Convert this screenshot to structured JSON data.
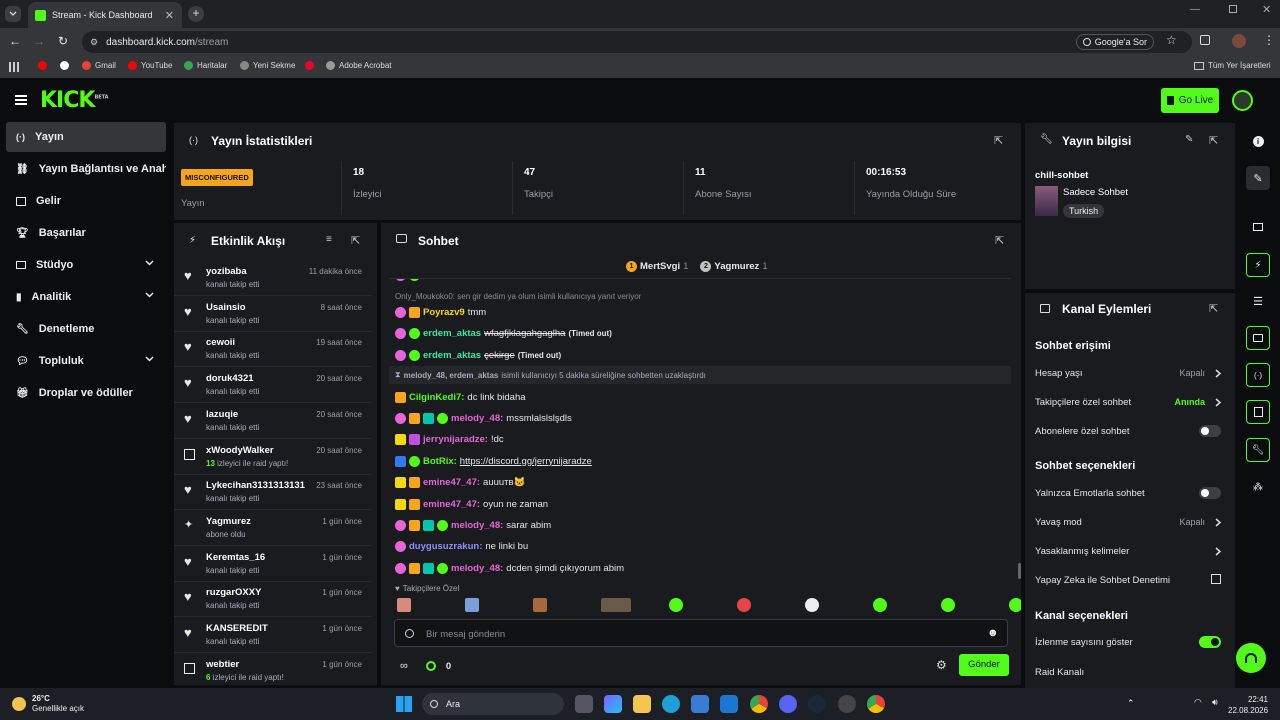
{
  "browser": {
    "tab_title": "Stream - Kick Dashboard",
    "url_host": "dashboard.kick.com",
    "url_path": "/stream",
    "google_btn": "Google'a Sor",
    "bookmarks": [
      "Gmail",
      "YouTube",
      "Haritalar",
      "Yeni Sekme",
      "Adobe Acrobat"
    ],
    "all_bookmarks": "Tüm Yer İşaretleri"
  },
  "topnav": {
    "logo": "KICK",
    "logo_badge": "BETA",
    "go_live": "Go Live"
  },
  "sidebar": {
    "items": [
      {
        "label": "Yayın"
      },
      {
        "label": "Yayın Bağlantısı ve Anahtarı"
      },
      {
        "label": "Gelir"
      },
      {
        "label": "Başarılar"
      },
      {
        "label": "Stüdyo"
      },
      {
        "label": "Analitik"
      },
      {
        "label": "Denetleme"
      },
      {
        "label": "Topluluk"
      },
      {
        "label": "Droplar ve ödüller"
      }
    ]
  },
  "stats": {
    "title": "Yayın İstatistikleri",
    "status_badge": "MISCONFIGURED",
    "status_label": "Yayın",
    "items": [
      {
        "value": "18",
        "label": "İzleyici"
      },
      {
        "value": "47",
        "label": "Takipçi"
      },
      {
        "value": "11",
        "label": "Abone Sayısı"
      },
      {
        "value": "00:16:53",
        "label": "Yayında Olduğu Süre"
      }
    ]
  },
  "events": {
    "title": "Etkinlik Akışı",
    "rows": [
      {
        "name": "yozibaba",
        "sub": "kanalı takip etti",
        "time": "11 dakika önce",
        "icon": "heart-icon"
      },
      {
        "name": "Usainsio",
        "sub": "kanalı takip etti",
        "time": "8 saat önce",
        "icon": "heart-icon"
      },
      {
        "name": "cewoii",
        "sub": "kanalı takip etti",
        "time": "19 saat önce",
        "icon": "heart-icon"
      },
      {
        "name": "doruk4321",
        "sub": "kanalı takip etti",
        "time": "20 saat önce",
        "icon": "heart-icon"
      },
      {
        "name": "lazuqie",
        "sub": "kanalı takip etti",
        "time": "20 saat önce",
        "icon": "heart-icon"
      },
      {
        "name": "xWoodyWalker",
        "sub_count": "13",
        "sub": "izleyici ile raid yaptı!",
        "time": "20 saat önce",
        "icon": "raid-icon"
      },
      {
        "name": "Lykecihan3131313131",
        "sub": "kanalı takip etti",
        "time": "23 saat önce",
        "icon": "heart-icon"
      },
      {
        "name": "Yagmurez",
        "sub": "abone oldu",
        "time": "1 gün önce",
        "icon": "sparkle-icon"
      },
      {
        "name": "Keremtas_16",
        "sub": "kanalı takip etti",
        "time": "1 gün önce",
        "icon": "heart-icon"
      },
      {
        "name": "ruzgarOXXY",
        "sub": "kanalı takip etti",
        "time": "1 gün önce",
        "icon": "heart-icon"
      },
      {
        "name": "KANSEREDIT",
        "sub": "kanalı takip etti",
        "time": "1 gün önce",
        "icon": "heart-icon"
      },
      {
        "name": "webtier",
        "sub_count": "6",
        "sub": "izleyici ile raid yaptı!",
        "time": "1 gün önce",
        "icon": "raid-icon"
      }
    ]
  },
  "chat": {
    "title": "Sohbet",
    "top_gifters": [
      {
        "rank": "1",
        "name": "MertSvgi",
        "count": "1"
      },
      {
        "rank": "2",
        "name": "Yagmurez",
        "count": "1"
      }
    ],
    "system1": "Only_Moukoko0: sen gir dedim ya olum isimli kullanıcıya yanıt veriyor",
    "messages": [
      {
        "user": "Poyrazv9",
        "color": "#f5d90a",
        "text": "tmm",
        "badges": [
          "sub",
          "crown"
        ]
      },
      {
        "user": "erdem_aktas",
        "color": "#3ee6a0",
        "text": "wfagfjklagahgaglha",
        "strike": true,
        "suffix": "(Timed out)",
        "badges": [
          "sub",
          "green"
        ]
      },
      {
        "user": "erdem_aktas",
        "color": "#3ee6a0",
        "text": "çekirge",
        "strike": true,
        "suffix": "(Timed out)",
        "badges": [
          "sub",
          "green"
        ]
      }
    ],
    "system2_users": "melody_48, erdem_aktas",
    "system2_text": "isimli kullanıcıyı 5 dakika süreliğine sohbetten uzaklaştırdı",
    "messages2": [
      {
        "user": "CilginKedi7:",
        "color": "#53fc18",
        "text": "dc link bidaha",
        "badges": [
          "crown"
        ]
      },
      {
        "user": "melody_48:",
        "color": "#e764d9",
        "text": "mssmlalslslşdls",
        "badges": [
          "sub",
          "crown",
          "mod",
          "green"
        ]
      },
      {
        "user": "jerrynijaradze:",
        "color": "#e764d9",
        "text": "!dc",
        "badges": [
          "kick",
          "mic"
        ]
      },
      {
        "user": "BotRix:",
        "color": "#53fc18",
        "text": "https://discord.gg/jerrynijaradze",
        "badges": [
          "bot",
          "verified"
        ]
      },
      {
        "user": "emine47_47:",
        "color": "#e764d9",
        "text": "auuuтв🐱",
        "badges": [
          "sub1",
          "crown"
        ]
      },
      {
        "user": "emine47_47:",
        "color": "#e764d9",
        "text": "oyun ne zaman",
        "badges": [
          "sub1",
          "crown"
        ]
      },
      {
        "user": "melody_48:",
        "color": "#e764d9",
        "text": "sarar abim",
        "badges": [
          "sub",
          "crown",
          "mod",
          "green"
        ]
      },
      {
        "user": "duygusuzrakun:",
        "color": "#8f8fff",
        "text": "ne linki bu",
        "badges": [
          "sub"
        ]
      },
      {
        "user": "melody_48:",
        "color": "#e764d9",
        "text": "dcden şimdi çıkıyorum abim",
        "badges": [
          "sub",
          "crown",
          "mod",
          "green"
        ]
      }
    ],
    "followers_only": "Takipçilere Özel",
    "input_placeholder": "Bir mesaj gönderin",
    "points": "0",
    "send": "Gönder"
  },
  "info": {
    "title": "Yayın bilgisi",
    "stream_title": "chill-sohbet",
    "category": "Sadece Sohbet",
    "tag": "Turkish"
  },
  "actions": {
    "title": "Kanal Eylemleri",
    "chat_access": "Sohbet erişimi",
    "account_age": "Hesap yaşı",
    "account_age_val": "Kapalı",
    "followers_chat": "Takipçilere özel sohbet",
    "followers_chat_val": "Anında",
    "subs_chat": "Abonelere özel sohbet",
    "chat_options": "Sohbet seçenekleri",
    "emote_only": "Yalnızca Emotlarla sohbet",
    "slow_mode": "Yavaş mod",
    "slow_mode_val": "Kapalı",
    "banned_words": "Yasaklanmış kelimeler",
    "ai_mod": "Yapay Zeka ile Sohbet Denetimi",
    "channel_options": "Kanal seçenekleri",
    "show_viewers": "İzlenme sayısını göster",
    "raid": "Raid Kanalı"
  },
  "taskbar": {
    "weather_temp": "26°C",
    "weather_desc": "Genellikle açık",
    "search": "Ara",
    "time": "22:41",
    "date": "22.08.2026"
  },
  "colors": {
    "kick_green": "#53fc18",
    "panel_bg": "#191b1f",
    "badge_orange": "#f7a51b"
  }
}
